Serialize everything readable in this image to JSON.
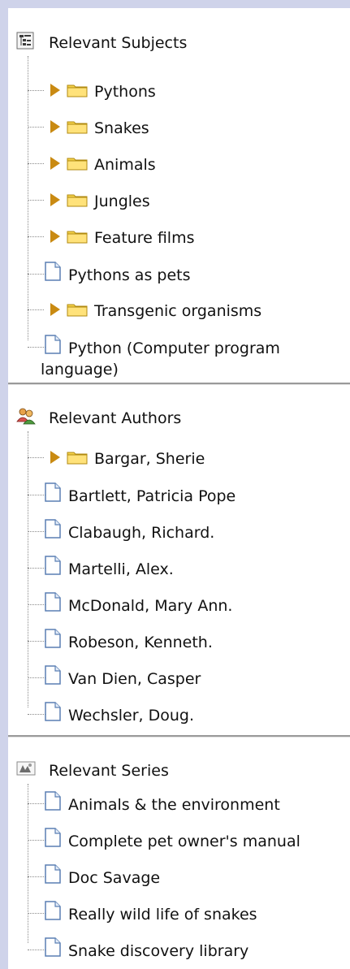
{
  "subjects": {
    "title": "Relevant Subjects",
    "icon": "tree-hierarchy-icon",
    "items": [
      {
        "label": "Pythons",
        "kind": "folder"
      },
      {
        "label": "Snakes",
        "kind": "folder"
      },
      {
        "label": "Animals",
        "kind": "folder"
      },
      {
        "label": "Jungles",
        "kind": "folder"
      },
      {
        "label": "Feature films",
        "kind": "folder"
      },
      {
        "label": "Pythons as pets",
        "kind": "doc"
      },
      {
        "label": "Transgenic organisms",
        "kind": "folder"
      },
      {
        "label": "Python (Computer program",
        "label_cont": "language)",
        "kind": "doc"
      }
    ]
  },
  "authors": {
    "title": "Relevant Authors",
    "icon": "people-icon",
    "items": [
      {
        "label": "Bargar, Sherie",
        "kind": "folder"
      },
      {
        "label": "Bartlett, Patricia Pope",
        "kind": "doc"
      },
      {
        "label": "Clabaugh, Richard.",
        "kind": "doc"
      },
      {
        "label": "Martelli, Alex.",
        "kind": "doc"
      },
      {
        "label": "McDonald, Mary Ann.",
        "kind": "doc"
      },
      {
        "label": "Robeson, Kenneth.",
        "kind": "doc"
      },
      {
        "label": "Van Dien, Casper",
        "kind": "doc"
      },
      {
        "label": "Wechsler, Doug.",
        "kind": "doc"
      }
    ]
  },
  "series": {
    "title": "Relevant Series",
    "icon": "series-books-icon",
    "items": [
      {
        "label": "Animals & the environment",
        "kind": "doc"
      },
      {
        "label": "Complete pet owner's manual",
        "kind": "doc"
      },
      {
        "label": "Doc Savage",
        "kind": "doc"
      },
      {
        "label": "Really wild life of snakes",
        "kind": "doc"
      },
      {
        "label": "Snake discovery library",
        "kind": "doc"
      }
    ]
  },
  "colors": {
    "background": "#cfd3ea",
    "panel": "#ffffff",
    "folder": "#f5d24a",
    "arrow": "#c98a12",
    "doc_border": "#5a7fb3"
  }
}
